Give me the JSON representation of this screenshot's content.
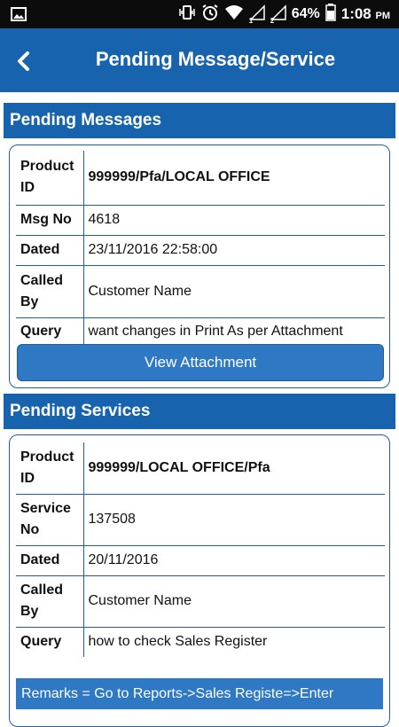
{
  "status_bar": {
    "battery": "64%",
    "time": "1:08",
    "ampm": "PM",
    "sim1": "1",
    "sim2": "2"
  },
  "app_bar": {
    "title": "Pending Message/Service"
  },
  "pending_messages": {
    "header": "Pending Messages",
    "rows": [
      {
        "label": "Product ID",
        "value": "999999/Pfa/LOCAL OFFICE"
      },
      {
        "label": "Msg No",
        "value": "4618"
      },
      {
        "label": "Dated",
        "value": "23/11/2016 22:58:00"
      },
      {
        "label": "Called By",
        "value": "Customer Name"
      },
      {
        "label": "Query",
        "value": "want changes in Print As per Attachment"
      }
    ],
    "button_label": "View Attachment"
  },
  "pending_services": {
    "header": "Pending Services",
    "rows": [
      {
        "label": "Product ID",
        "value": "999999/LOCAL OFFICE/Pfa"
      },
      {
        "label": "Service No",
        "value": "137508"
      },
      {
        "label": "Dated",
        "value": "20/11/2016"
      },
      {
        "label": "Called By",
        "value": "Customer Name"
      },
      {
        "label": "Query",
        "value": "how to check Sales Register"
      }
    ],
    "remarks": "Remarks = Go to Reports->Sales Registe=>Enter"
  }
}
